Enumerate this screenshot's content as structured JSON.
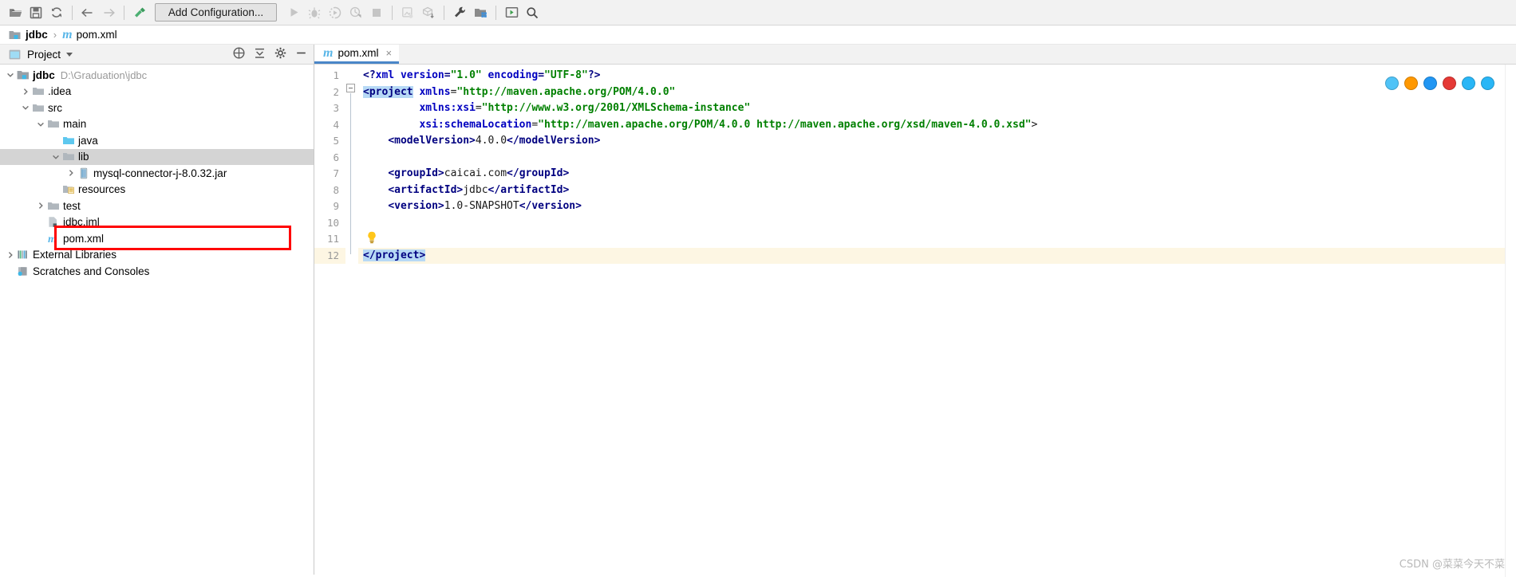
{
  "toolbar": {
    "icons": [
      {
        "name": "open-folder-icon",
        "label": "Open"
      },
      {
        "name": "save-all-icon",
        "label": "Save All"
      },
      {
        "name": "sync-refresh-icon",
        "label": "Synchronize"
      },
      {
        "name": "navigate-back-icon",
        "label": "Back"
      },
      {
        "name": "navigate-forward-icon",
        "label": "Forward"
      },
      {
        "name": "build-hammer-icon",
        "label": "Build Project"
      },
      {
        "name": "run-icon",
        "label": "Run"
      },
      {
        "name": "debug-icon",
        "label": "Debug"
      },
      {
        "name": "run-with-coverage-icon",
        "label": "Run with Coverage"
      },
      {
        "name": "profile-icon",
        "label": "Profile"
      },
      {
        "name": "stop-icon",
        "label": "Stop"
      },
      {
        "name": "update-project-icon",
        "label": "Update Project"
      },
      {
        "name": "commit-icon",
        "label": "Commit"
      },
      {
        "name": "settings-wrench-icon",
        "label": "Settings"
      },
      {
        "name": "project-structure-icon",
        "label": "Project Structure"
      },
      {
        "name": "terminal-icon",
        "label": "Terminal"
      },
      {
        "name": "search-everywhere-icon",
        "label": "Search Everywhere"
      }
    ],
    "add_configuration_label": "Add Configuration..."
  },
  "breadcrumb": {
    "project": "jdbc",
    "separator": "›",
    "file_icon": "m",
    "file": "pom.xml"
  },
  "sidebar": {
    "panel_title": "Project",
    "header_actions": [
      {
        "name": "select-opened-file-icon",
        "label": "Select Opened File"
      },
      {
        "name": "collapse-all-icon",
        "label": "Collapse All"
      },
      {
        "name": "settings-gear-icon",
        "label": "Settings"
      },
      {
        "name": "hide-panel-icon",
        "label": "Hide"
      }
    ],
    "tree": [
      {
        "label": "jdbc",
        "path": "D:\\Graduation\\jdbc",
        "icon": "module-icon",
        "indent": 0,
        "arrow": "down",
        "bold": true,
        "selected": false
      },
      {
        "label": ".idea",
        "path": "",
        "icon": "folder-icon",
        "indent": 1,
        "arrow": "right",
        "bold": false,
        "selected": false
      },
      {
        "label": "src",
        "path": "",
        "icon": "folder-icon",
        "indent": 1,
        "arrow": "down",
        "bold": false,
        "selected": false
      },
      {
        "label": "main",
        "path": "",
        "icon": "folder-icon",
        "indent": 2,
        "arrow": "down",
        "bold": false,
        "selected": false
      },
      {
        "label": "java",
        "path": "",
        "icon": "source-folder-icon",
        "indent": 3,
        "arrow": "none",
        "bold": false,
        "selected": false
      },
      {
        "label": "lib",
        "path": "",
        "icon": "folder-icon",
        "indent": 3,
        "arrow": "down",
        "bold": false,
        "selected": true
      },
      {
        "label": "mysql-connector-j-8.0.32.jar",
        "path": "",
        "icon": "jar-icon",
        "indent": 4,
        "arrow": "right",
        "bold": false,
        "selected": false
      },
      {
        "label": "resources",
        "path": "",
        "icon": "resources-folder-icon",
        "indent": 3,
        "arrow": "none",
        "bold": false,
        "selected": false
      },
      {
        "label": "test",
        "path": "",
        "icon": "folder-icon",
        "indent": 2,
        "arrow": "right",
        "bold": false,
        "selected": false
      },
      {
        "label": "jdbc.iml",
        "path": "",
        "icon": "iml-file-icon",
        "indent": 2,
        "arrow": "none",
        "bold": false,
        "selected": false
      },
      {
        "label": "pom.xml",
        "path": "",
        "icon": "maven-file-icon",
        "indent": 2,
        "arrow": "none",
        "bold": false,
        "selected": false
      },
      {
        "label": "External Libraries",
        "path": "",
        "icon": "libraries-icon",
        "indent": 0,
        "arrow": "right",
        "bold": false,
        "selected": false
      },
      {
        "label": "Scratches and Consoles",
        "path": "",
        "icon": "scratches-icon",
        "indent": 0,
        "arrow": "none",
        "bold": false,
        "selected": false
      }
    ],
    "highlight_label": "mysql-connector-j-8.0.32.jar",
    "highlight_color": "#ff0000"
  },
  "editor": {
    "tab_icon": "m",
    "tab_label": "pom.xml",
    "tab_close": "×",
    "line_numbers": [
      1,
      2,
      3,
      4,
      5,
      6,
      7,
      8,
      9,
      10,
      11,
      12
    ],
    "highlighted_line": 12,
    "browser_icons": [
      {
        "name": "chrome-browser-icon",
        "color": "#4fc3f7"
      },
      {
        "name": "firefox-browser-icon",
        "color": "#ff9800"
      },
      {
        "name": "edge-browser-icon",
        "color": "#2196f3"
      },
      {
        "name": "opera-browser-icon",
        "color": "#e53935"
      },
      {
        "name": "safari-browser-icon",
        "color": "#29b6f6"
      },
      {
        "name": "explorer-browser-icon",
        "color": "#29b6f6"
      }
    ],
    "code_lines": [
      {
        "n": 1,
        "indent": 0,
        "tokens": [
          {
            "t": "<?",
            "c": "pi"
          },
          {
            "t": "xml",
            "c": "attr"
          },
          {
            "t": " version",
            "c": "attr"
          },
          {
            "t": "=",
            "c": "pi"
          },
          {
            "t": "\"1.0\"",
            "c": "val"
          },
          {
            "t": " encoding",
            "c": "attr"
          },
          {
            "t": "=",
            "c": "pi"
          },
          {
            "t": "\"UTF-8\"",
            "c": "val"
          },
          {
            "t": "?>",
            "c": "pi"
          }
        ]
      },
      {
        "n": 2,
        "indent": 0,
        "tokens": [
          {
            "t": "<project",
            "c": "tag sel"
          },
          {
            "t": " ",
            "c": "txt"
          },
          {
            "t": "xmlns",
            "c": "attr"
          },
          {
            "t": "=",
            "c": "txt"
          },
          {
            "t": "\"http://maven.apache.org/POM/4.0.0\"",
            "c": "val"
          }
        ]
      },
      {
        "n": 3,
        "indent": 9,
        "tokens": [
          {
            "t": "xmlns:xsi",
            "c": "attr"
          },
          {
            "t": "=",
            "c": "txt"
          },
          {
            "t": "\"http://www.w3.org/2001/XMLSchema-instance\"",
            "c": "val"
          }
        ]
      },
      {
        "n": 4,
        "indent": 9,
        "tokens": [
          {
            "t": "xsi:schemaLocation",
            "c": "attr"
          },
          {
            "t": "=",
            "c": "txt"
          },
          {
            "t": "\"http://maven.apache.org/POM/4.0.0 http://maven.apache.org/xsd/maven-4.0.0.xsd\"",
            "c": "val"
          },
          {
            "t": ">",
            "c": "txt"
          }
        ]
      },
      {
        "n": 5,
        "indent": 4,
        "tokens": [
          {
            "t": "<modelVersion>",
            "c": "tag"
          },
          {
            "t": "4.0.0",
            "c": "txt"
          },
          {
            "t": "</modelVersion>",
            "c": "tag"
          }
        ]
      },
      {
        "n": 6,
        "indent": 0,
        "tokens": []
      },
      {
        "n": 7,
        "indent": 4,
        "tokens": [
          {
            "t": "<groupId>",
            "c": "tag"
          },
          {
            "t": "caicai.com",
            "c": "txt"
          },
          {
            "t": "</groupId>",
            "c": "tag"
          }
        ]
      },
      {
        "n": 8,
        "indent": 4,
        "tokens": [
          {
            "t": "<artifactId>",
            "c": "tag"
          },
          {
            "t": "jdbc",
            "c": "txt"
          },
          {
            "t": "</artifactId>",
            "c": "tag"
          }
        ]
      },
      {
        "n": 9,
        "indent": 4,
        "tokens": [
          {
            "t": "<version>",
            "c": "tag"
          },
          {
            "t": "1.0-SNAPSHOT",
            "c": "txt"
          },
          {
            "t": "</version>",
            "c": "tag"
          }
        ]
      },
      {
        "n": 10,
        "indent": 0,
        "tokens": []
      },
      {
        "n": 11,
        "indent": 0,
        "tokens": []
      },
      {
        "n": 12,
        "indent": 0,
        "tokens": [
          {
            "t": "</project>",
            "c": "tag sel"
          }
        ]
      }
    ],
    "intention_bulb": "lightbulb-icon"
  },
  "watermark": "CSDN @菜菜今天不菜"
}
